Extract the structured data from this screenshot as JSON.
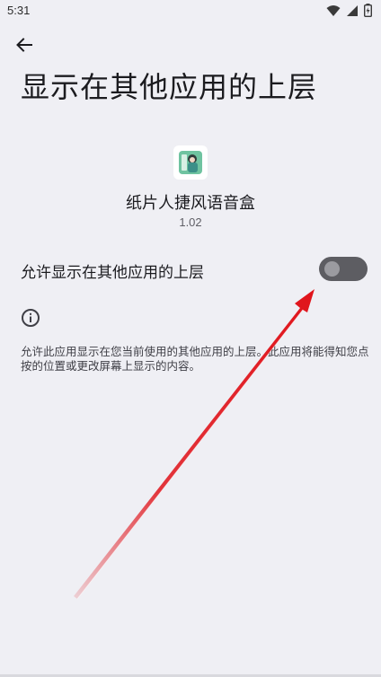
{
  "status_bar": {
    "time": "5:31",
    "icons": [
      "wifi-icon",
      "signal-icon",
      "battery-icon"
    ]
  },
  "header": {
    "back_icon": "arrow-back-icon",
    "title": "显示在其他应用的上层"
  },
  "app": {
    "name": "纸片人捷风语音盒",
    "version": "1.02",
    "icon": "app-avatar-icon"
  },
  "setting": {
    "label": "允许显示在其他应用的上层",
    "enabled": false
  },
  "info": {
    "icon": "info-icon",
    "description": "允许此应用显示在您当前使用的其他应用的上层。此应用将能得知您点按的位置或更改屏幕上显示的内容。"
  },
  "colors": {
    "background": "#efeff4",
    "toggle_track": "#5d5d62",
    "toggle_knob": "#9b9ba0",
    "annotation_arrow": "#e0141b"
  }
}
